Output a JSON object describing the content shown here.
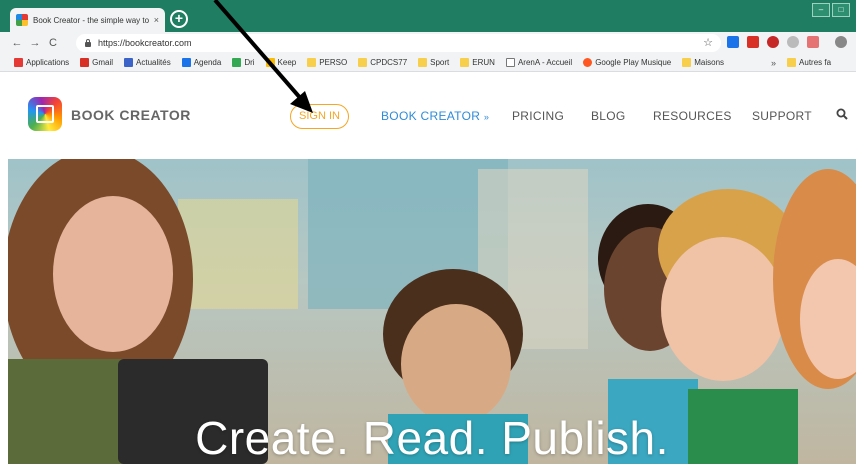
{
  "browser": {
    "tab_title": "Book Creator - the simple way to",
    "tab_close": "×",
    "new_tab": "+",
    "url": "https://bookcreator.com",
    "win_min": "–",
    "win_max": "□",
    "back": "←",
    "forward": "→",
    "reload": "C",
    "star": "☆"
  },
  "bookmarks": {
    "items": [
      {
        "label": "Applications",
        "color": "#e53935"
      },
      {
        "label": "Gmail",
        "color": "#d93025"
      },
      {
        "label": "Actualités",
        "color": "#3c64c8"
      },
      {
        "label": "Agenda",
        "color": "#1a73e8"
      },
      {
        "label": "Dri",
        "color": "#34a853"
      },
      {
        "label": "Keep",
        "color": "#fbbc04"
      },
      {
        "label": "PERSO",
        "color": "#f7cf4d"
      },
      {
        "label": "CPDCS77",
        "color": "#f7cf4d"
      },
      {
        "label": "Sport",
        "color": "#f7cf4d"
      },
      {
        "label": "ERUN",
        "color": "#f7cf4d"
      },
      {
        "label": "ArenA - Accueil",
        "color": "#ffffff"
      },
      {
        "label": "Google Play Musique",
        "color": "#ff5722"
      },
      {
        "label": "Maisons",
        "color": "#f7cf4d"
      }
    ],
    "more": "»",
    "other": "Autres fa"
  },
  "site": {
    "logo_text": "BOOK CREATOR",
    "sign_in": "SIGN IN",
    "nav_book_creator": "BOOK CREATOR",
    "nav_chevron": "»",
    "nav_pricing": "PRICING",
    "nav_blog": "BLOG",
    "nav_resources": "RESOURCES",
    "nav_support": "SUPPORT"
  },
  "hero": {
    "headline": "Create. Read. Publish."
  },
  "colors": {
    "accent_orange": "#f5a623",
    "nav_blue": "#2e8bd8",
    "titlebar_green": "#1f7d61"
  }
}
